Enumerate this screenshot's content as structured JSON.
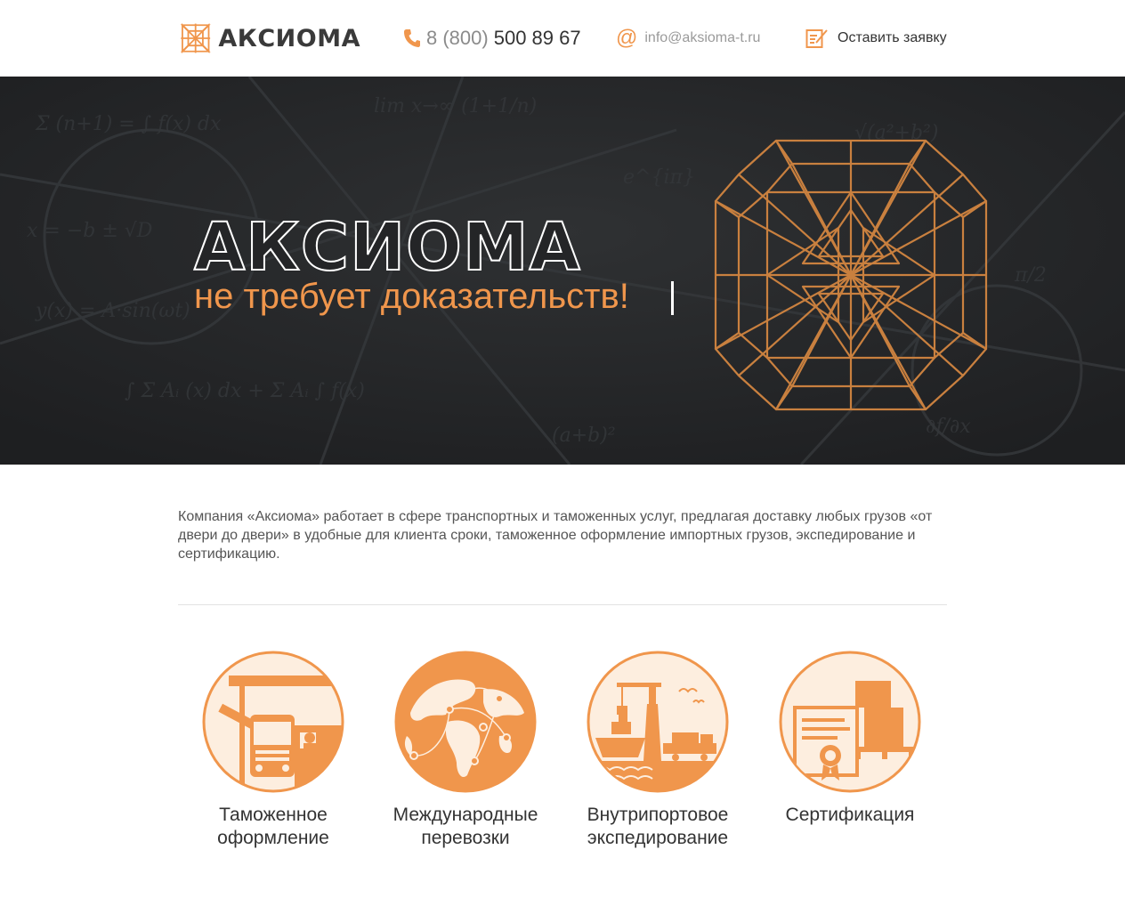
{
  "header": {
    "logo_text": "АКСИОМА",
    "phone_code": "8 (800)",
    "phone_number": "500 89 67",
    "email": "info@aksioma-t.ru",
    "request_label": "Оставить заявку"
  },
  "hero": {
    "title": "АКСИОМА",
    "subtitle": "не требует доказательств!"
  },
  "intro": {
    "text": "Компания «Аксиома» работает в сфере транспортных и таможенных услуг, предлагая доставку любых грузов «от двери до двери» в удобные для клиента сроки, таможенное оформление импортных грузов, экспедирование и сертификацию."
  },
  "services": [
    {
      "label": "Таможенное оформление",
      "icon": "customs-icon"
    },
    {
      "label": "Международные перевозки",
      "icon": "globe-icon"
    },
    {
      "label": "Внутрипортовое экспедирование",
      "icon": "port-icon"
    },
    {
      "label": "Сертификация",
      "icon": "certificate-icon"
    }
  ],
  "colors": {
    "accent": "#f0964c",
    "accent_light": "#fdeedf",
    "hero_bg": "#242527",
    "text": "#333333"
  }
}
